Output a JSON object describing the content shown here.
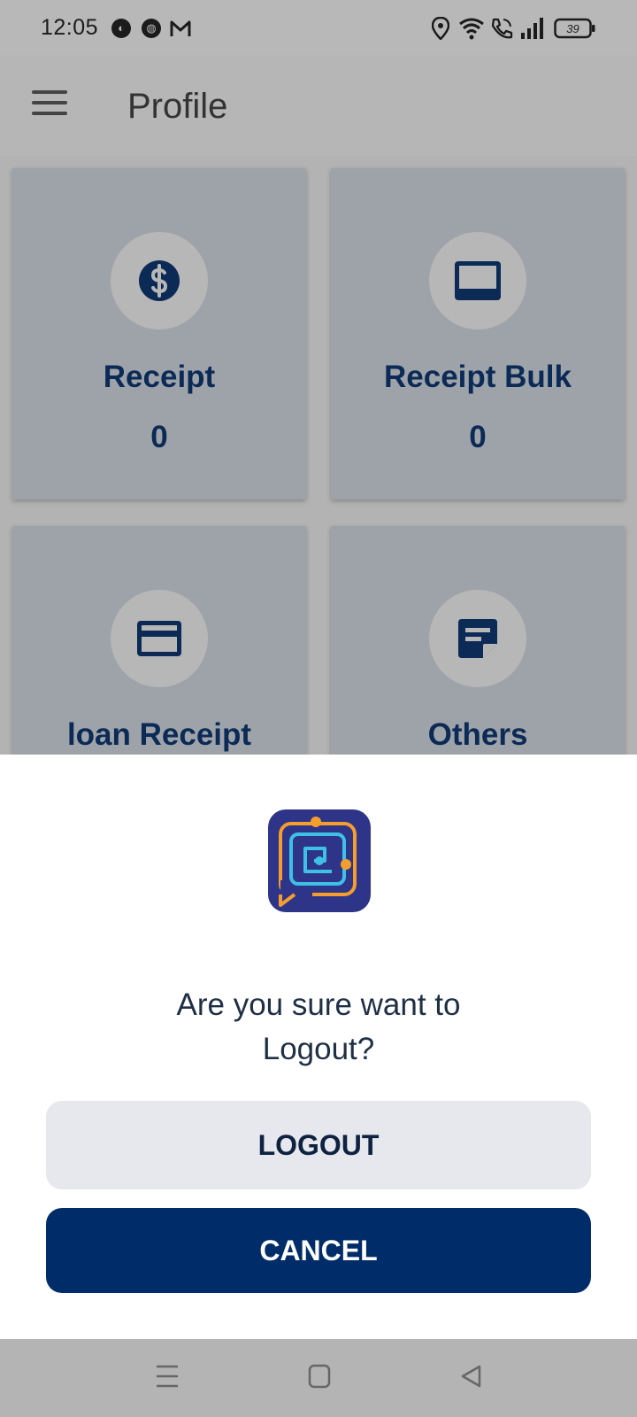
{
  "status_bar": {
    "time": "12:05",
    "notification_icons": [
      "app-notification-icon",
      "app-notification-icon",
      "gmail-icon"
    ],
    "system_icons": [
      "location-icon",
      "wifi-icon",
      "wifi-call-icon",
      "signal-icon",
      "battery-icon"
    ],
    "battery": "39"
  },
  "app_bar": {
    "menu_icon": "hamburger-menu-icon",
    "title": "Profile"
  },
  "tiles": [
    {
      "label": "Receipt",
      "count": "0",
      "icon": "dollar-circle-icon"
    },
    {
      "label": "Receipt Bulk",
      "count": "0",
      "icon": "receipt-bulk-icon"
    },
    {
      "label": "loan Receipt",
      "icon": "credit-card-icon"
    },
    {
      "label": "Others",
      "icon": "note-icon"
    }
  ],
  "dialog": {
    "logo": "app-logo",
    "question_line1": "Are you sure want to",
    "question_line2": "Logout?",
    "logout_label": "LOGOUT",
    "cancel_label": "CANCEL"
  },
  "nav_bar": {
    "icons": [
      "recents-icon",
      "home-icon",
      "back-icon"
    ]
  },
  "colors": {
    "primary": "#002c69",
    "tile_text": "#0b2a55",
    "logout_bg": "#e6e8ee",
    "sheet_bg": "#ffffff"
  }
}
